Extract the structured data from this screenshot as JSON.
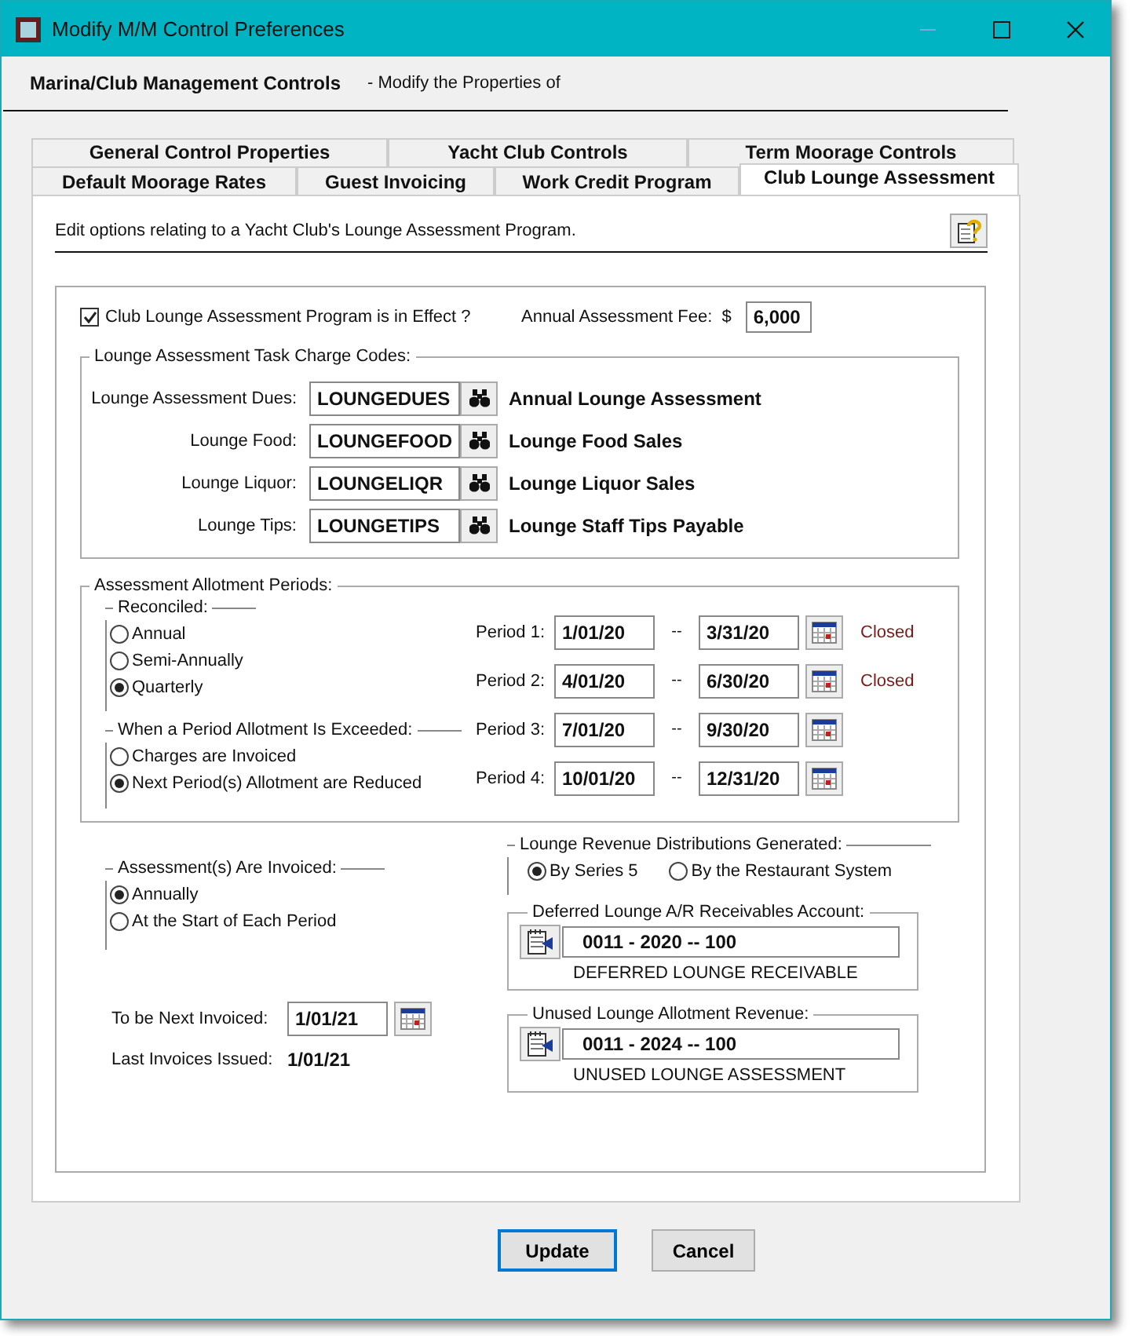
{
  "window": {
    "title": "Modify M/M Control Preferences"
  },
  "header": {
    "title": "Marina/Club Management Controls",
    "subtitle": "- Modify the Properties of"
  },
  "tab_rows": [
    {
      "tabs": [
        {
          "label": "General Control Properties",
          "selected": false
        },
        {
          "label": "Yacht Club Controls",
          "selected": false
        },
        {
          "label": "Term Moorage Controls",
          "selected": false
        }
      ]
    },
    {
      "tabs": [
        {
          "label": "Default Moorage Rates",
          "selected": false
        },
        {
          "label": "Guest Invoicing",
          "selected": false
        },
        {
          "label": "Work Credit Program",
          "selected": false
        },
        {
          "label": "Club Lounge Assessment",
          "selected": true
        }
      ]
    }
  ],
  "description": "Edit options relating to a Yacht Club's Lounge Assessment Program.",
  "program_enabled": {
    "label": "Club Lounge Assessment Program is in Effect ?",
    "checked": true
  },
  "annual_fee": {
    "label": "Annual Assessment Fee:",
    "currency": "$",
    "value": "6,000"
  },
  "charge_codes": {
    "title": "Lounge Assessment Task Charge Codes:",
    "rows": [
      {
        "label": "Lounge Assessment Dues:",
        "code": "LOUNGEDUES",
        "description": "Annual Lounge Assessment"
      },
      {
        "label": "Lounge Food:",
        "code": "LOUNGEFOOD",
        "description": "Lounge Food Sales"
      },
      {
        "label": "Lounge Liquor:",
        "code": "LOUNGELIQR",
        "description": "Lounge Liquor Sales"
      },
      {
        "label": "Lounge Tips:",
        "code": "LOUNGETIPS",
        "description": "Lounge Staff Tips Payable"
      }
    ]
  },
  "allotment": {
    "title": "Assessment Allotment Periods:",
    "reconciled": {
      "title": "Reconciled:",
      "options": [
        {
          "label": "Annual",
          "selected": false
        },
        {
          "label": "Semi-Annually",
          "selected": false
        },
        {
          "label": "Quarterly",
          "selected": true
        }
      ]
    },
    "exceeded": {
      "title": "When a Period Allotment Is Exceeded:",
      "options": [
        {
          "label": "Charges are Invoiced",
          "selected": false
        },
        {
          "label": "Next Period(s) Allotment are Reduced",
          "selected": true
        }
      ]
    },
    "periods": [
      {
        "label": "Period 1:",
        "start": "1/01/20",
        "separator": "--",
        "end": "3/31/20",
        "status": "Closed"
      },
      {
        "label": "Period 2:",
        "start": "4/01/20",
        "separator": "--",
        "end": "6/30/20",
        "status": "Closed"
      },
      {
        "label": "Period 3:",
        "start": "7/01/20",
        "separator": "--",
        "end": "9/30/20"
      },
      {
        "label": "Period 4:",
        "start": "10/01/20",
        "separator": "--",
        "end": "12/31/20"
      }
    ]
  },
  "invoiced": {
    "title": "Assessment(s) Are Invoiced:",
    "options": [
      {
        "label": "Annually",
        "selected": true
      },
      {
        "label": "At the Start of Each Period",
        "selected": false
      }
    ]
  },
  "next_invoiced": {
    "label": "To be Next Invoiced:",
    "value": "1/01/21"
  },
  "last_issued": {
    "label": "Last Invoices Issued:",
    "value": "1/01/21"
  },
  "distributions": {
    "title": "Lounge Revenue Distributions Generated:",
    "options": [
      {
        "label": "By Series 5",
        "selected": true
      },
      {
        "label": "By the Restaurant System",
        "selected": false
      }
    ]
  },
  "accounts": [
    {
      "title": "Deferred Lounge A/R Receivables Account:",
      "value": "0011 - 2020 -- 100",
      "description": "DEFERRED LOUNGE RECEIVABLE"
    },
    {
      "title": "Unused Lounge Allotment Revenue:",
      "value": "0011 - 2024 -- 100",
      "description": "UNUSED LOUNGE ASSESSMENT"
    }
  ],
  "buttons": [
    {
      "label": "Update",
      "default": true
    },
    {
      "label": "Cancel",
      "default": false
    }
  ]
}
